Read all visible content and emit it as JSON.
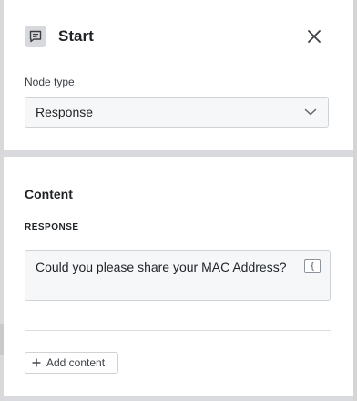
{
  "header": {
    "title": "Start",
    "icon": "chat-icon",
    "close_icon": "close-icon"
  },
  "node_type": {
    "label": "Node type",
    "selected": "Response",
    "dropdown_icon": "chevron-down-icon"
  },
  "content": {
    "heading": "Content",
    "response_label": "RESPONSE",
    "response_text": "Could you please share your MAC Address?",
    "variable_button_glyph": "{",
    "add_content_label": "Add content"
  },
  "colors": {
    "panel_bg": "#ffffff",
    "field_bg": "#f6f7f8",
    "border": "#cfd3d8",
    "text": "#1f2328"
  }
}
